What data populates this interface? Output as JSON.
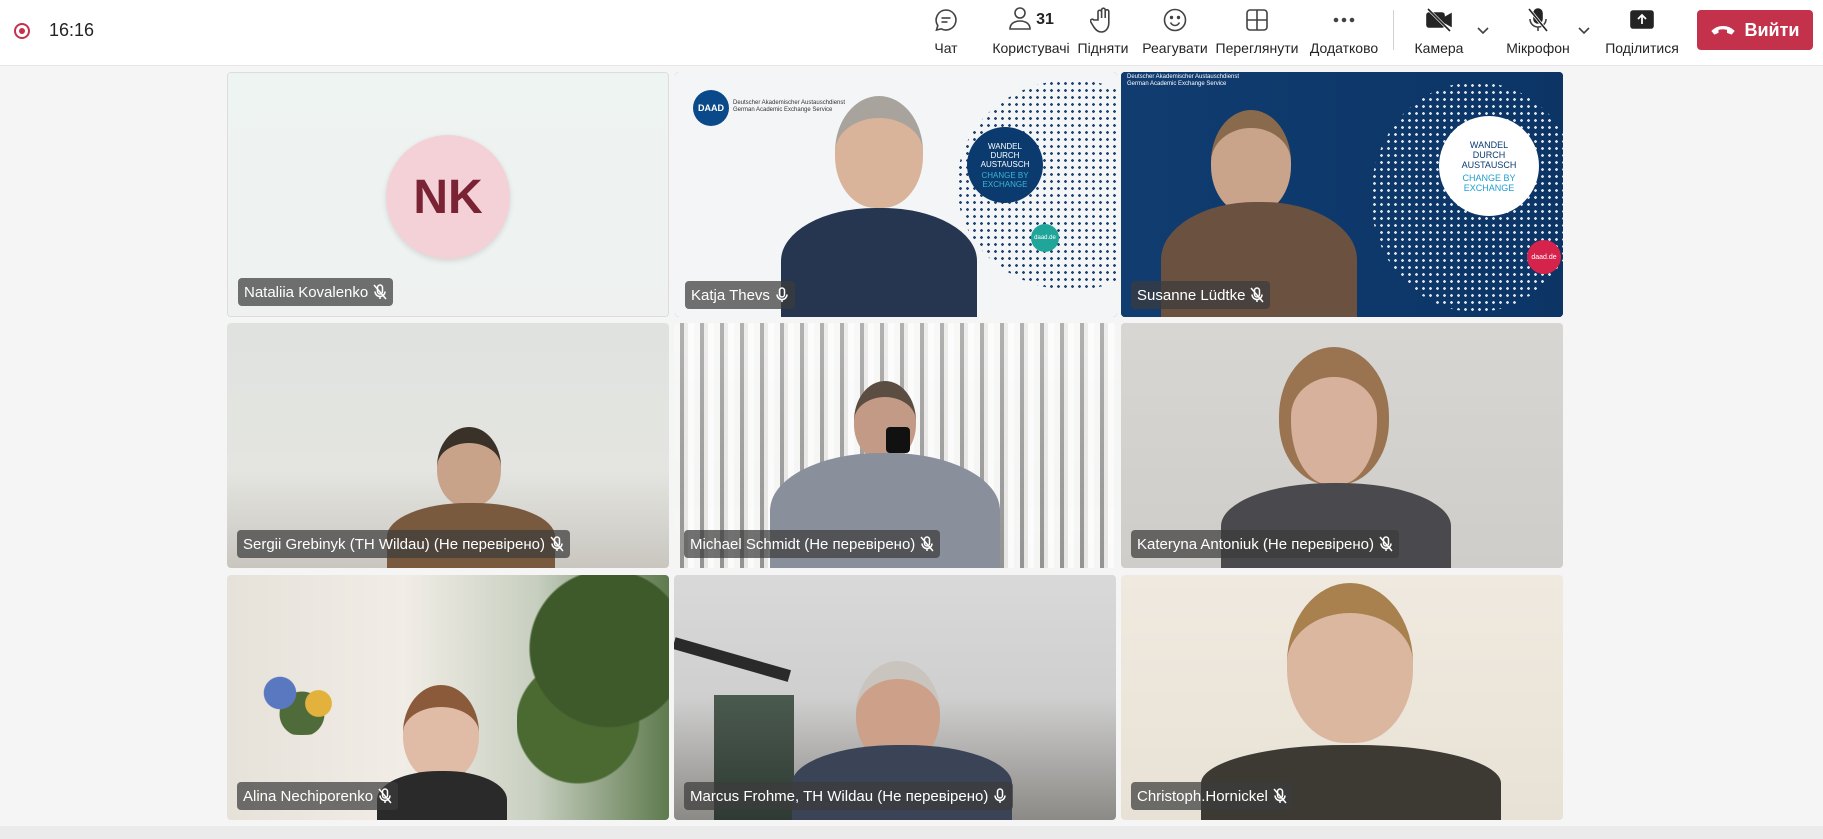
{
  "header": {
    "clock": "16:16",
    "participants_count": "31",
    "toolbar": {
      "chat": "Чат",
      "people": "Користувачі",
      "raise": "Підняти",
      "react": "Реагувати",
      "view": "Переглянути",
      "more": "Додатково",
      "camera": "Камера",
      "mic": "Мікрофон",
      "share": "Поділитися",
      "leave": "Вийти"
    }
  },
  "participants": [
    {
      "name": "Nataliia Kovalenko",
      "initials": "NK"
    },
    {
      "name": "Katja Thevs"
    },
    {
      "name": "Susanne Lüdtke"
    },
    {
      "name": "Sergii Grebinyk (TH Wildau) (Не перевірено)"
    },
    {
      "name": "Michael Schmidt (Не перевірено)"
    },
    {
      "name": "Kateryna Antoniuk (Не перевірено)"
    },
    {
      "name": "Alina Nechiporenko"
    },
    {
      "name": "Marcus Frohme, TH Wildau (Не перевірено)"
    },
    {
      "name": "Christoph.Hornickel"
    }
  ],
  "backgrounds": {
    "daad_logo": "DAAD",
    "daad_line1": "Deutscher Akademischer Austauschdienst",
    "daad_line2": "German Academic Exchange Service",
    "wandel_de": "WANDEL DURCH AUSTAUSCH",
    "wandel_en": "CHANGE BY EXCHANGE",
    "daad_url": "daad.de"
  },
  "colors": {
    "accent": "#5b5fc7",
    "leave": "#c4314b",
    "daad_blue": "#0b3a6e"
  }
}
